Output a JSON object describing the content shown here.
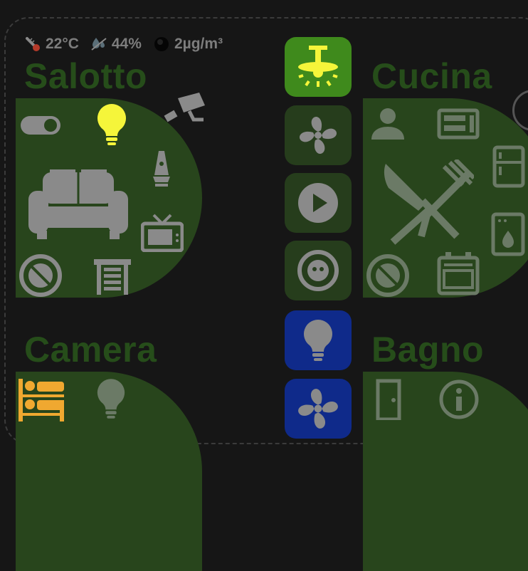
{
  "status_bar": {
    "temperature": "22°C",
    "humidity": "44%",
    "pm25": "2µg/m³"
  },
  "rooms": [
    {
      "name": "Salotto"
    },
    {
      "name": "Cucina"
    },
    {
      "name": "Camera"
    },
    {
      "name": "Bagno"
    }
  ],
  "quick_tiles": [
    {
      "name": "ceiling-fan-light",
      "state": "on"
    },
    {
      "name": "fan",
      "state": "off"
    },
    {
      "name": "play",
      "state": "off"
    },
    {
      "name": "robot-vacuum",
      "state": "off"
    },
    {
      "name": "light",
      "state": "blue"
    },
    {
      "name": "fan",
      "state": "blue"
    }
  ],
  "colors": {
    "background": "#161616",
    "room_card": "#28451c",
    "room_title": "#264d1a",
    "tile_off": "#263d1c",
    "tile_on": "#3f8a1c",
    "tile_blue": "#0f2a8a",
    "bulb_on": "#f5f53a",
    "bed_active": "#f0a830",
    "icon_grey": "#8a8a8a"
  }
}
